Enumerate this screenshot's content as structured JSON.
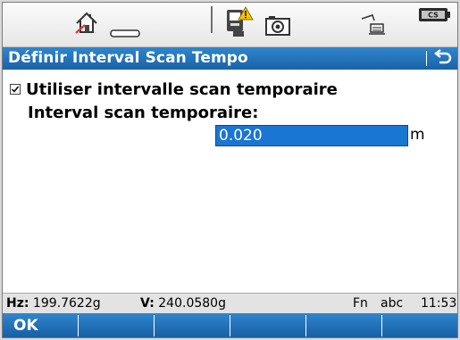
{
  "statusbar": {
    "icons": [
      "home-house-icon",
      "prism-icon",
      "instrument-warning-icon",
      "camera-icon",
      "scan-area-icon",
      "cs-battery-icon"
    ],
    "cs_label": "CS"
  },
  "titlebar": {
    "title": "Définir Interval Scan Tempo",
    "back_icon": "return-arrow-icon"
  },
  "form": {
    "checkbox_label": "Utiliser intervalle scan temporaire",
    "checkbox_checked": true,
    "field_label": "Interval scan temporaire:",
    "field_value": "0.020",
    "field_unit": "m"
  },
  "infobar": {
    "hz_label": "Hz:",
    "hz_value": "199.7622g",
    "v_label": "V:",
    "v_value": "240.0580g",
    "fn": "Fn",
    "input_mode": "abc",
    "time": "11:53"
  },
  "softkeys": [
    "OK",
    "",
    "",
    "",
    "",
    ""
  ],
  "colors": {
    "accent": "#1f6fbf",
    "highlight": "#1976d2",
    "warning": "#f5c400"
  }
}
